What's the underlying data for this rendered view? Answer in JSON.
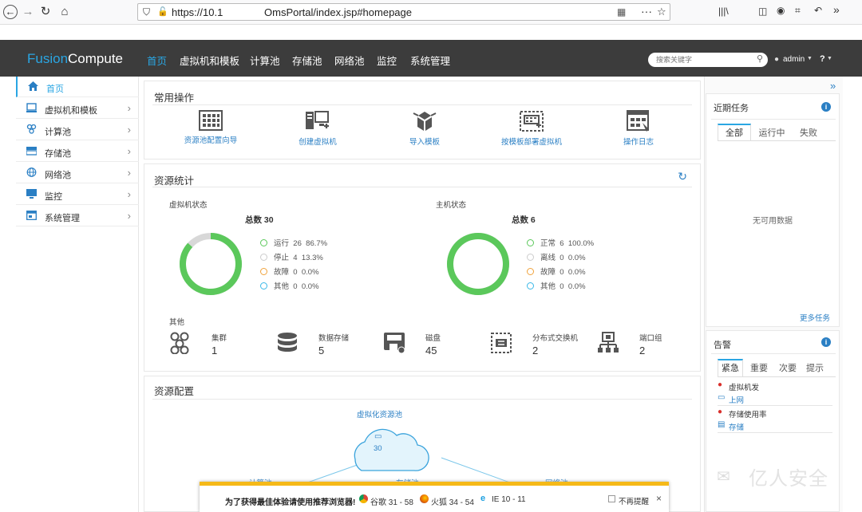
{
  "browser": {
    "url_prefix": "https://10.1",
    "url_suffix": "OmsPortal/index.jsp#homepage",
    "more_label": "···"
  },
  "header": {
    "logo_part1": "Fusion",
    "logo_part2": "Compute",
    "nav": [
      "首页",
      "虚拟机和模板",
      "计算池",
      "存储池",
      "网络池",
      "监控",
      "系统管理"
    ],
    "search_placeholder": "搜索关键字",
    "user": "admin",
    "help": "?"
  },
  "sidebar": {
    "items": [
      {
        "label": "首页",
        "icon": "home-icon"
      },
      {
        "label": "虚拟机和模板",
        "icon": "vm-icon"
      },
      {
        "label": "计算池",
        "icon": "compute-icon"
      },
      {
        "label": "存储池",
        "icon": "storage-icon"
      },
      {
        "label": "网络池",
        "icon": "network-icon"
      },
      {
        "label": "监控",
        "icon": "monitor-icon"
      },
      {
        "label": "系统管理",
        "icon": "system-icon"
      }
    ]
  },
  "common_ops": {
    "title": "常用操作",
    "items": [
      {
        "label": "资源池配置向导",
        "icon": "grid-wizard-icon"
      },
      {
        "label": "创建虚拟机",
        "icon": "create-vm-icon"
      },
      {
        "label": "导入模板",
        "icon": "import-template-icon"
      },
      {
        "label": "按模板部署虚拟机",
        "icon": "deploy-template-icon"
      },
      {
        "label": "操作日志",
        "icon": "log-icon"
      }
    ]
  },
  "stats": {
    "title": "资源统计",
    "vm": {
      "title": "虚拟机状态",
      "total_label": "总数 30",
      "ring_fraction": 0.867,
      "legend": [
        {
          "name": "运行",
          "count": "26",
          "pct": "86.7%",
          "color": "#5bc85b"
        },
        {
          "name": "停止",
          "count": "4",
          "pct": "13.3%",
          "color": "#cccccc"
        },
        {
          "name": "故障",
          "count": "0",
          "pct": "0.0%",
          "color": "#f0a23b"
        },
        {
          "name": "其他",
          "count": "0",
          "pct": "0.0%",
          "color": "#3ab8e8"
        }
      ]
    },
    "host": {
      "title": "主机状态",
      "total_label": "总数 6",
      "ring_fraction": 1.0,
      "legend": [
        {
          "name": "正常",
          "count": "6",
          "pct": "100.0%",
          "color": "#5bc85b"
        },
        {
          "name": "离线",
          "count": "0",
          "pct": "0.0%",
          "color": "#cccccc"
        },
        {
          "name": "故障",
          "count": "0",
          "pct": "0.0%",
          "color": "#f0a23b"
        },
        {
          "name": "其他",
          "count": "0",
          "pct": "0.0%",
          "color": "#3ab8e8"
        }
      ]
    },
    "other_title": "其他",
    "others": [
      {
        "name": "集群",
        "count": "1",
        "icon": "cluster-icon"
      },
      {
        "name": "数据存储",
        "count": "5",
        "icon": "datastore-icon"
      },
      {
        "name": "磁盘",
        "count": "45",
        "icon": "disk-icon"
      },
      {
        "name": "分布式交换机",
        "count": "2",
        "icon": "dvswitch-icon"
      },
      {
        "name": "端口组",
        "count": "2",
        "icon": "portgroup-icon"
      }
    ]
  },
  "config": {
    "title": "资源配置",
    "pool_label": "虚拟化资源池",
    "pool_count": "30",
    "children": [
      "计算池",
      "存储池",
      "网络池"
    ]
  },
  "tasks": {
    "title": "近期任务",
    "tabs": [
      "全部",
      "运行中",
      "失败"
    ],
    "empty": "无可用数据",
    "more": "更多任务"
  },
  "alarms": {
    "title": "告警",
    "tabs": [
      "紧急",
      "重要",
      "次要",
      "提示"
    ],
    "items": [
      {
        "line1": "虚拟机发",
        "line2": "上网"
      },
      {
        "line1": "存储使用率",
        "line2": "存储"
      }
    ]
  },
  "browser_bar": {
    "message": "为了获得最佳体验请使用推荐浏览器!",
    "chrome": "谷歌 31 - 58",
    "firefox": "火狐 34 - 54",
    "ie": "IE 10 - 11",
    "no_remind": "不再提醒",
    "close": "×"
  },
  "watermark": "亿人安全"
}
